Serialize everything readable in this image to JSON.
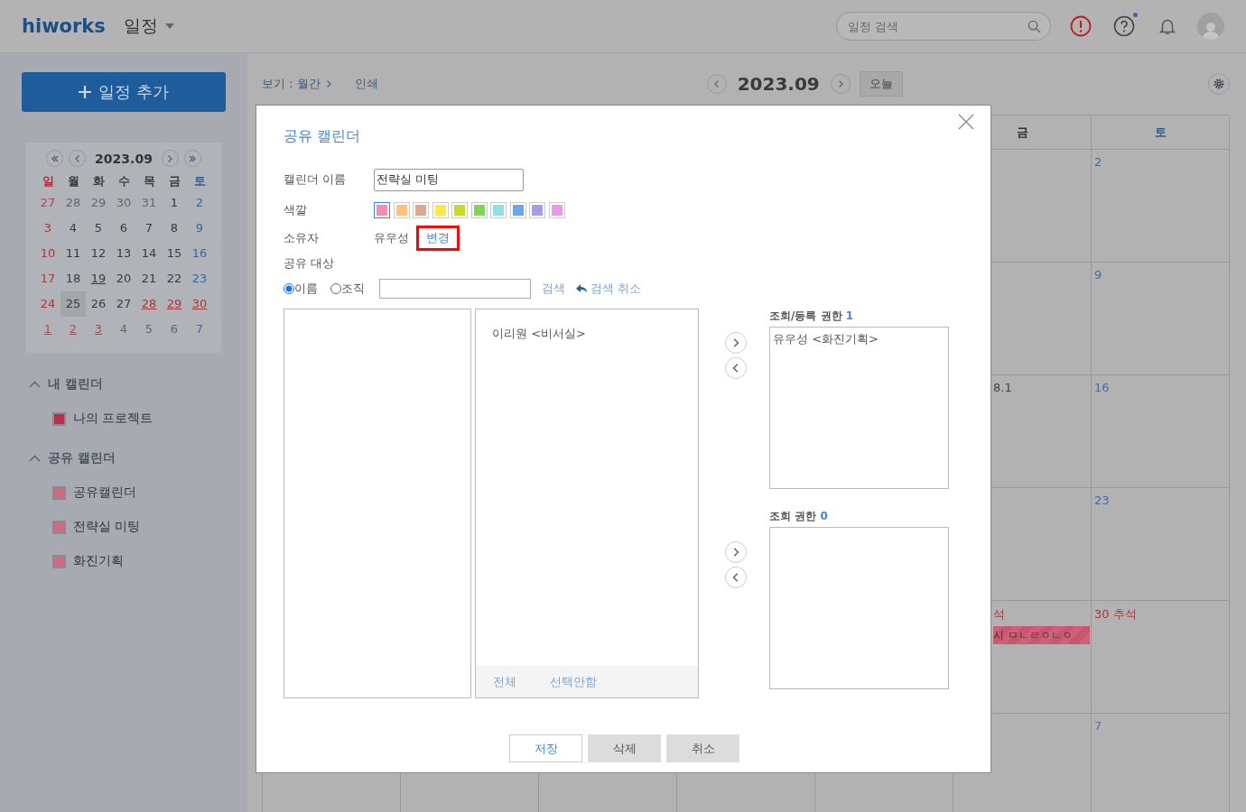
{
  "header": {
    "logo": "hiworks",
    "app_menu": "일정",
    "search": {
      "placeholder": "일정 검색"
    },
    "help_notice": true
  },
  "sidebar": {
    "add_button": "일정 추가",
    "mini_calendar": {
      "title": "2023.09",
      "weekdays": [
        "일",
        "월",
        "화",
        "수",
        "목",
        "금",
        "토"
      ],
      "weeks": [
        [
          {
            "t": "27",
            "kind": "sunday",
            "muted": true,
            "event": false,
            "selected": false
          },
          {
            "t": "28",
            "kind": "weekday",
            "muted": true,
            "event": false,
            "selected": false
          },
          {
            "t": "29",
            "kind": "weekday",
            "muted": true,
            "event": false,
            "selected": false
          },
          {
            "t": "30",
            "kind": "weekday",
            "muted": true,
            "event": false,
            "selected": false
          },
          {
            "t": "31",
            "kind": "weekday",
            "muted": true,
            "event": false,
            "selected": false
          },
          {
            "t": "1",
            "kind": "weekday",
            "muted": false,
            "event": false,
            "selected": false
          },
          {
            "t": "2",
            "kind": "saturday",
            "muted": false,
            "event": false,
            "selected": false
          }
        ],
        [
          {
            "t": "3",
            "kind": "sunday",
            "muted": false,
            "event": false,
            "selected": false
          },
          {
            "t": "4",
            "kind": "weekday",
            "muted": false,
            "event": false,
            "selected": false
          },
          {
            "t": "5",
            "kind": "weekday",
            "muted": false,
            "event": false,
            "selected": false
          },
          {
            "t": "6",
            "kind": "weekday",
            "muted": false,
            "event": false,
            "selected": false
          },
          {
            "t": "7",
            "kind": "weekday",
            "muted": false,
            "event": false,
            "selected": false
          },
          {
            "t": "8",
            "kind": "weekday",
            "muted": false,
            "event": false,
            "selected": false
          },
          {
            "t": "9",
            "kind": "saturday",
            "muted": false,
            "event": false,
            "selected": false
          }
        ],
        [
          {
            "t": "10",
            "kind": "sunday",
            "muted": false,
            "event": false,
            "selected": false
          },
          {
            "t": "11",
            "kind": "weekday",
            "muted": false,
            "event": false,
            "selected": false
          },
          {
            "t": "12",
            "kind": "weekday",
            "muted": false,
            "event": false,
            "selected": false
          },
          {
            "t": "13",
            "kind": "weekday",
            "muted": false,
            "event": false,
            "selected": false
          },
          {
            "t": "14",
            "kind": "weekday",
            "muted": false,
            "event": false,
            "selected": false
          },
          {
            "t": "15",
            "kind": "weekday",
            "muted": false,
            "event": false,
            "selected": false
          },
          {
            "t": "16",
            "kind": "saturday",
            "muted": false,
            "event": false,
            "selected": false
          }
        ],
        [
          {
            "t": "17",
            "kind": "sunday",
            "muted": false,
            "event": false,
            "selected": false
          },
          {
            "t": "18",
            "kind": "weekday",
            "muted": false,
            "event": false,
            "selected": false
          },
          {
            "t": "19",
            "kind": "weekday",
            "muted": false,
            "event": true,
            "selected": false
          },
          {
            "t": "20",
            "kind": "weekday",
            "muted": false,
            "event": false,
            "selected": false
          },
          {
            "t": "21",
            "kind": "weekday",
            "muted": false,
            "event": false,
            "selected": false
          },
          {
            "t": "22",
            "kind": "weekday",
            "muted": false,
            "event": false,
            "selected": false
          },
          {
            "t": "23",
            "kind": "saturday",
            "muted": false,
            "event": false,
            "selected": false
          }
        ],
        [
          {
            "t": "24",
            "kind": "sunday",
            "muted": false,
            "event": false,
            "selected": false
          },
          {
            "t": "25",
            "kind": "weekday",
            "muted": false,
            "event": false,
            "selected": true
          },
          {
            "t": "26",
            "kind": "weekday",
            "muted": false,
            "event": false,
            "selected": false
          },
          {
            "t": "27",
            "kind": "weekday",
            "muted": false,
            "event": false,
            "selected": false
          },
          {
            "t": "28",
            "kind": "holiday",
            "muted": false,
            "event": true,
            "selected": false
          },
          {
            "t": "29",
            "kind": "holiday",
            "muted": false,
            "event": true,
            "selected": false
          },
          {
            "t": "30",
            "kind": "holiday",
            "muted": false,
            "event": true,
            "selected": false
          }
        ],
        [
          {
            "t": "1",
            "kind": "sunday",
            "muted": true,
            "event": true,
            "selected": false
          },
          {
            "t": "2",
            "kind": "holiday",
            "muted": true,
            "event": true,
            "selected": false
          },
          {
            "t": "3",
            "kind": "holiday",
            "muted": true,
            "event": true,
            "selected": false
          },
          {
            "t": "4",
            "kind": "weekday",
            "muted": true,
            "event": false,
            "selected": false
          },
          {
            "t": "5",
            "kind": "weekday",
            "muted": true,
            "event": false,
            "selected": false
          },
          {
            "t": "6",
            "kind": "weekday",
            "muted": true,
            "event": false,
            "selected": false
          },
          {
            "t": "7",
            "kind": "saturday",
            "muted": true,
            "event": false,
            "selected": false
          }
        ]
      ]
    },
    "sections": [
      {
        "title": "내 캘린더",
        "expanded": true,
        "items": [
          {
            "label": "나의 프로젝트",
            "color": "#b8304c"
          }
        ]
      },
      {
        "title": "공유 캘린더",
        "expanded": true,
        "items": [
          {
            "label": "공유캘린더",
            "color": "#d06a80"
          },
          {
            "label": "전략실 미팅",
            "color": "#d06a80"
          },
          {
            "label": "화진기획",
            "color": "#d06a80"
          }
        ]
      }
    ]
  },
  "toolbar": {
    "view": "보기 : 월간",
    "print": "인쇄",
    "month": "2023.09",
    "today": "오늘"
  },
  "calendar": {
    "weekdays": [
      {
        "label": "금",
        "kind": "weekday"
      },
      {
        "label": "토",
        "kind": "saturday"
      }
    ],
    "weeks": [
      {
        "sat": {
          "text": "2",
          "kind": "saturday"
        }
      },
      {
        "sat": {
          "text": "9",
          "kind": "saturday"
        }
      },
      {
        "fri": {
          "text": "8.1",
          "kind": "plain"
        },
        "sat": {
          "text": "16",
          "kind": "saturday"
        }
      },
      {
        "sat": {
          "text": "23",
          "kind": "saturday"
        }
      },
      {
        "fri": {
          "text": "석",
          "kind": "holiday",
          "event": {
            "title": "시 ㅁㄴㄹㅇㄴㅇ",
            "color": "#d0607a"
          }
        },
        "sat": {
          "text": "30 추석",
          "kind": "holiday"
        }
      },
      {
        "sat": {
          "text": "7",
          "kind": "muted"
        }
      }
    ]
  },
  "dialog": {
    "title": "공유 캘린더",
    "name": {
      "label": "캘린더 이름",
      "value": "전략실 미팅"
    },
    "color": {
      "label": "색깔",
      "swatches": [
        {
          "color": "#f48fb1",
          "selected": true
        },
        {
          "color": "#ffc27a",
          "selected": false
        },
        {
          "color": "#dba898",
          "selected": false
        },
        {
          "color": "#fbe84a",
          "selected": false
        },
        {
          "color": "#c8d92a",
          "selected": false
        },
        {
          "color": "#7dd65a",
          "selected": false
        },
        {
          "color": "#8ee0e6",
          "selected": false
        },
        {
          "color": "#6fa6e8",
          "selected": false
        },
        {
          "color": "#a99cf0",
          "selected": false
        },
        {
          "color": "#e79ae8",
          "selected": false
        }
      ]
    },
    "owner": {
      "label": "소유자",
      "value": "유우성",
      "change": "변경",
      "highlighted": true
    },
    "target_label": "공유 대상",
    "search": {
      "options": [
        {
          "label": "이름",
          "selected": true
        },
        {
          "label": "조직",
          "selected": false
        }
      ],
      "search_link": "검색",
      "cancel_link": "검색 취소"
    },
    "candidates": {
      "items": [
        "이리원 <비서실>"
      ],
      "select_all": "전체",
      "select_none": "선택안함"
    },
    "groups": [
      {
        "title": "조회/등록 권한",
        "count": "1",
        "members": [
          "유우성 <화진기획>"
        ]
      },
      {
        "title": "조회 권한",
        "count": "0"
      }
    ],
    "buttons": [
      {
        "label": "저장",
        "kind": "primary"
      },
      {
        "label": "삭제",
        "kind": "secondary"
      },
      {
        "label": "취소",
        "kind": "secondary"
      }
    ]
  }
}
